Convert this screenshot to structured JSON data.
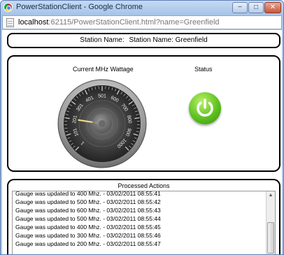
{
  "window": {
    "title": "PowerStationClient - Google Chrome",
    "min_label": "−",
    "max_label": "□",
    "close_label": "✕"
  },
  "address": {
    "host": "localhost",
    "rest": ":62115/PowerStationClient.html?name=Greenfield"
  },
  "station": {
    "label": "Station Name:",
    "value": "Station Name: Greenfield"
  },
  "gauge": {
    "title": "Current MHz Wattage",
    "value": 200,
    "min": 1,
    "max": 1000,
    "ticks": [
      "1",
      "101",
      "201",
      "301",
      "401",
      "501",
      "600",
      "700",
      "800",
      "900",
      "1000"
    ]
  },
  "status": {
    "title": "Status",
    "icon": "power-icon",
    "color": "#5ec21f"
  },
  "actions": {
    "title": "Processed Actions",
    "items": [
      "Gauge was updated to 400 Mhz. - 03/02/2011 08:55:41",
      "Gauge was updated to 500 Mhz. - 03/02/2011 08:55:42",
      "Gauge was updated to 600 Mhz. - 03/02/2011 08:55:43",
      "Gauge was updated to 500 Mhz. - 03/02/2011 08:55:44",
      "Gauge was updated to 400 Mhz. - 03/02/2011 08:55:45",
      "Gauge was updated to 300 Mhz. - 03/02/2011 08:55:46",
      "Gauge was updated to 200 Mhz. - 03/02/2011 08:55:47"
    ],
    "scroll_up_label": "▲"
  }
}
